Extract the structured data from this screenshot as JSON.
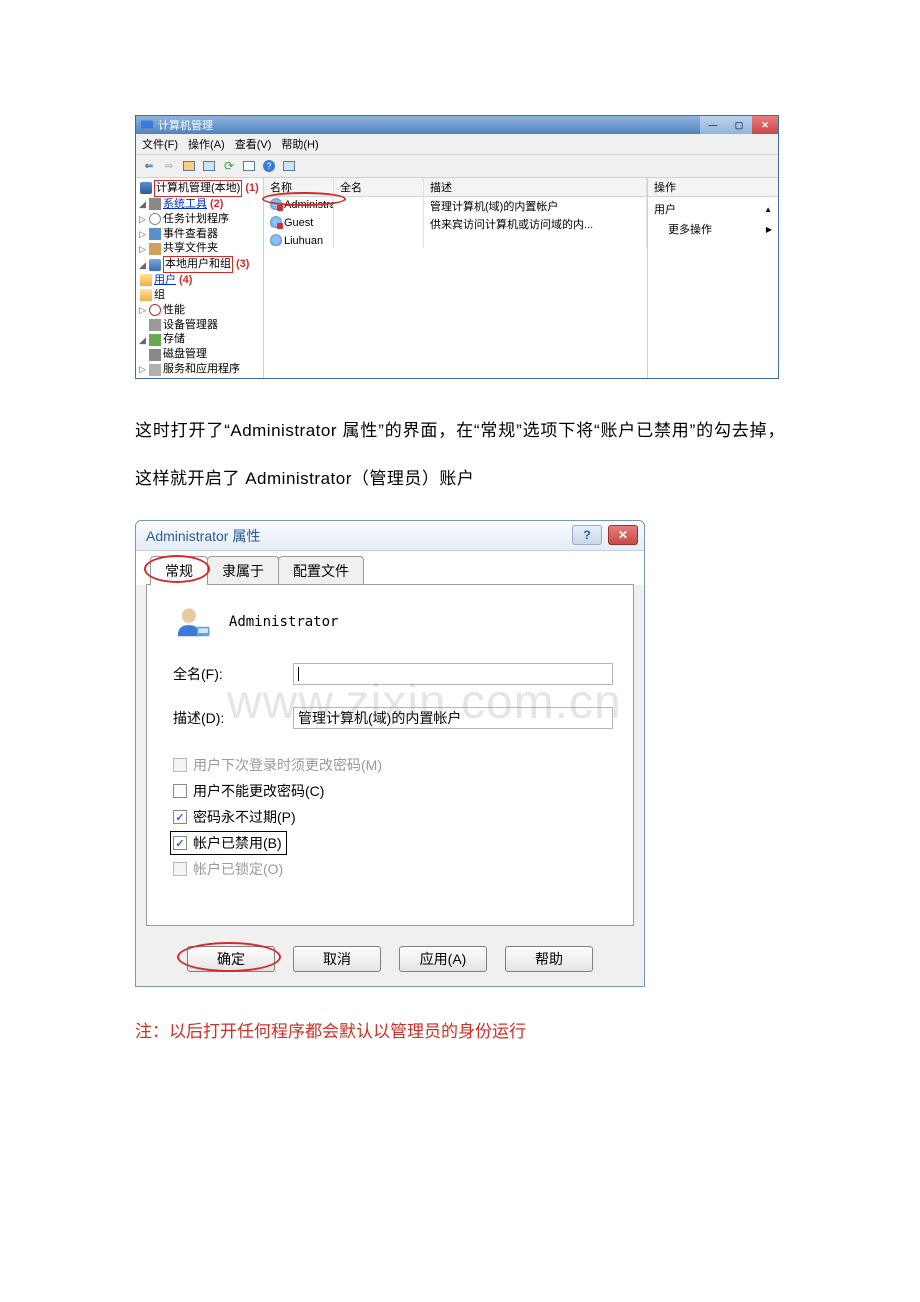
{
  "mmc": {
    "title": "计算机管理",
    "menu": {
      "file": "文件(F)",
      "action": "操作(A)",
      "view": "查看(V)",
      "help": "帮助(H)"
    },
    "tree": {
      "root": "计算机管理(本地)",
      "system_tools": "系统工具",
      "task_scheduler": "任务计划程序",
      "event_viewer": "事件查看器",
      "shared_folders": "共享文件夹",
      "local_users": "本地用户和组",
      "users": "用户",
      "groups": "组",
      "performance": "性能",
      "device_mgr": "设备管理器",
      "storage": "存储",
      "disk_mgmt": "磁盘管理",
      "services_apps": "服务和应用程序",
      "ann1": "(1)",
      "ann2": "(2)",
      "ann3": "(3)",
      "ann4": "(4)"
    },
    "list": {
      "headers": {
        "name": "名称",
        "fullname": "全名",
        "desc": "描述"
      },
      "rows": [
        {
          "name": "Administrat...",
          "fullname": "",
          "desc": "管理计算机(域)的内置帐户"
        },
        {
          "name": "Guest",
          "fullname": "",
          "desc": "供来宾访问计算机或访问域的内..."
        },
        {
          "name": "Liuhuan",
          "fullname": "",
          "desc": ""
        }
      ]
    },
    "actions": {
      "header": "操作",
      "users": "用户",
      "more": "更多操作"
    }
  },
  "paragraph": "这时打开了“Administrator 属性”的界面，在“常规”选项下将“账户已禁用”的勾去掉，这样就开启了 Administrator（管理员）账户",
  "dialog": {
    "title": "Administrator 属性",
    "tabs": {
      "general": "常规",
      "member": "隶属于",
      "profile": "配置文件"
    },
    "account_name": "Administrator",
    "fullname_label": "全名(F):",
    "fullname_value": "",
    "desc_label": "描述(D):",
    "desc_value": "管理计算机(域)的内置帐户",
    "checks": {
      "must_change": "用户下次登录时须更改密码(M)",
      "cannot_change": "用户不能更改密码(C)",
      "never_expire": "密码永不过期(P)",
      "disabled": "帐户已禁用(B)",
      "locked": "帐户已锁定(O)"
    },
    "buttons": {
      "ok": "确定",
      "cancel": "取消",
      "apply": "应用(A)",
      "help": "帮助"
    }
  },
  "watermark": "www.zixin.com.cn",
  "note": "注：以后打开任何程序都会默认以管理员的身份运行"
}
